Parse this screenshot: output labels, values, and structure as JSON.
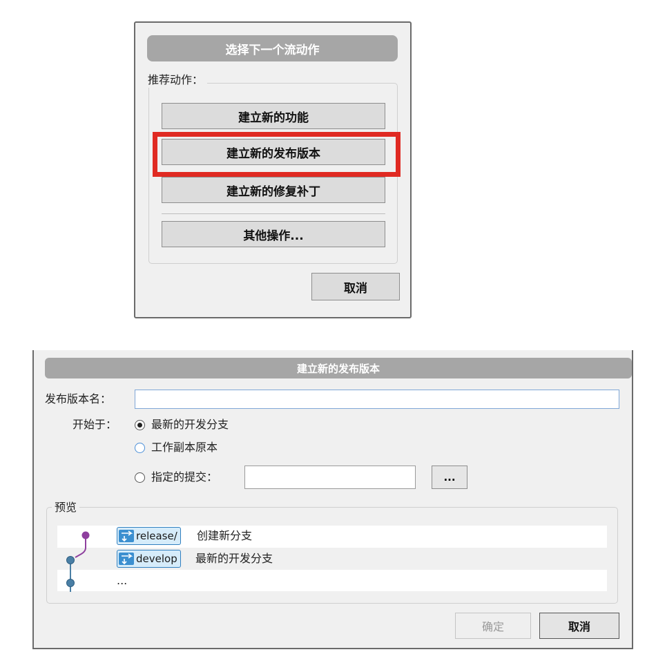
{
  "dialog1": {
    "title": "选择下一个流动作",
    "group_label": "推荐动作：",
    "actions": [
      "建立新的功能",
      "建立新的发布版本",
      "建立新的修复补丁"
    ],
    "other": "其他操作...",
    "cancel": "取消",
    "highlight_color": "#e02a22"
  },
  "dialog2": {
    "title": "建立新的发布版本",
    "release_name_label": "发布版本名：",
    "release_name_value": "",
    "start_label": "开始于：",
    "options": [
      "最新的开发分支",
      "工作副本原本",
      "指定的提交："
    ],
    "selected_option": 0,
    "commit_value": "",
    "browse_button": "...",
    "preview_label": "预览",
    "preview_rows": [
      {
        "tag": "release/",
        "text": "创建新分支"
      },
      {
        "tag": "develop",
        "text": "最新的开发分支"
      },
      {
        "tag": "",
        "text": "..."
      }
    ],
    "ok": "确定",
    "cancel": "取消",
    "colors": {
      "release_node": "#8e3f9e",
      "develop_node": "#4a7fa5",
      "tag_bg": "#d6ecfa"
    }
  }
}
